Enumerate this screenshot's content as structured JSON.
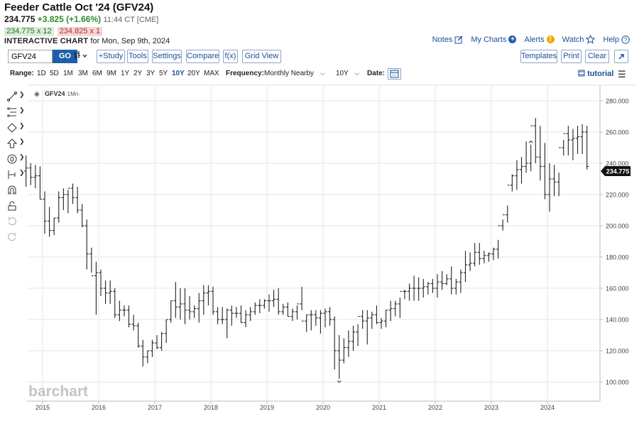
{
  "header": {
    "title": "Feeder Cattle Oct '24 (GFV24)",
    "last": "234.775",
    "change": "+3.825 (+1.66%)",
    "time": "11:44 CT [CME]",
    "bid": "234.775 x 12",
    "ask": "234.825 x 1",
    "chart_label": "INTERACTIVE CHART",
    "chart_date": " for Mon, Sep 9th, 2024"
  },
  "links": {
    "notes": "Notes",
    "mycharts": "My Charts",
    "alerts": "Alerts",
    "watch": "Watch",
    "help": "Help"
  },
  "toolbar": {
    "symbol": "GFV24",
    "go": "GO",
    "study": "+Study",
    "tools": "Tools",
    "settings": "Settings",
    "compare": "Compare",
    "fx": "f(x)",
    "gridview": "Grid View",
    "templates": "Templates",
    "print": "Print",
    "clear": "Clear"
  },
  "rangebar": {
    "range_label": "Range:",
    "ranges": [
      "1D",
      "5D",
      "1M",
      "3M",
      "6M",
      "9M",
      "1Y",
      "2Y",
      "3Y",
      "5Y",
      "10Y",
      "20Y",
      "MAX"
    ],
    "active_range": "10Y",
    "frequency_label": "Frequency:",
    "frequency": "Monthly Nearby",
    "period": "10Y",
    "date_label": "Date:",
    "tutorial": "tutorial"
  },
  "chart_data": {
    "type": "ohlc",
    "symbol_label": "GFV24",
    "interval_label": "·1Mn·",
    "watermark": "barchart",
    "last_price_label": "234.775",
    "ylim": [
      95,
      287
    ],
    "y_ticks": [
      100,
      120,
      140,
      160,
      180,
      200,
      220,
      240,
      260,
      280
    ],
    "x_years": [
      "2015",
      "2016",
      "2017",
      "2018",
      "2019",
      "2020",
      "2021",
      "2022",
      "2023",
      "2024"
    ],
    "x_start": "2014-09",
    "x_end": "2024-09",
    "grid": true,
    "markers": {
      "high": "2023-09",
      "low": "2020-04"
    },
    "months": [
      "2014-09",
      "2014-10",
      "2014-11",
      "2014-12",
      "2015-01",
      "2015-02",
      "2015-03",
      "2015-04",
      "2015-05",
      "2015-06",
      "2015-07",
      "2015-08",
      "2015-09",
      "2015-10",
      "2015-11",
      "2015-12",
      "2016-01",
      "2016-02",
      "2016-03",
      "2016-04",
      "2016-05",
      "2016-06",
      "2016-07",
      "2016-08",
      "2016-09",
      "2016-10",
      "2016-11",
      "2016-12",
      "2017-01",
      "2017-02",
      "2017-03",
      "2017-04",
      "2017-05",
      "2017-06",
      "2017-07",
      "2017-08",
      "2017-09",
      "2017-10",
      "2017-11",
      "2017-12",
      "2018-01",
      "2018-02",
      "2018-03",
      "2018-04",
      "2018-05",
      "2018-06",
      "2018-07",
      "2018-08",
      "2018-09",
      "2018-10",
      "2018-11",
      "2018-12",
      "2019-01",
      "2019-02",
      "2019-03",
      "2019-04",
      "2019-05",
      "2019-06",
      "2019-07",
      "2019-08",
      "2019-09",
      "2019-10",
      "2019-11",
      "2019-12",
      "2020-01",
      "2020-02",
      "2020-03",
      "2020-04",
      "2020-05",
      "2020-06",
      "2020-07",
      "2020-08",
      "2020-09",
      "2020-10",
      "2020-11",
      "2020-12",
      "2021-01",
      "2021-02",
      "2021-03",
      "2021-04",
      "2021-05",
      "2021-06",
      "2021-07",
      "2021-08",
      "2021-09",
      "2021-10",
      "2021-11",
      "2021-12",
      "2022-01",
      "2022-02",
      "2022-03",
      "2022-04",
      "2022-05",
      "2022-06",
      "2022-07",
      "2022-08",
      "2022-09",
      "2022-10",
      "2022-11",
      "2022-12",
      "2023-01",
      "2023-02",
      "2023-03",
      "2023-04",
      "2023-05",
      "2023-06",
      "2023-07",
      "2023-08",
      "2023-09",
      "2023-10",
      "2023-11",
      "2023-12",
      "2024-01",
      "2024-02",
      "2024-03",
      "2024-04",
      "2024-05",
      "2024-06",
      "2024-07",
      "2024-08",
      "2024-09"
    ],
    "open": [
      235,
      237,
      231,
      232,
      217,
      203,
      197,
      205,
      218,
      220,
      224,
      218,
      210,
      200,
      182,
      168,
      170,
      160,
      157,
      158,
      143,
      146,
      146,
      137,
      136,
      123,
      116,
      120,
      125,
      122,
      131,
      140,
      152,
      148,
      150,
      146,
      145,
      147,
      152,
      157,
      158,
      145,
      140,
      140,
      146,
      144,
      144,
      138,
      143,
      145,
      149,
      149,
      152,
      152,
      153,
      145,
      148,
      142,
      145,
      150,
      139,
      143,
      143,
      141,
      144,
      145,
      140,
      120,
      114,
      122,
      126,
      132,
      142,
      139,
      141,
      143,
      138,
      139,
      146,
      147,
      150,
      158,
      158,
      160,
      160,
      160,
      161,
      163,
      160,
      164,
      163,
      166,
      160,
      164,
      170,
      175,
      176,
      183,
      179,
      181,
      182,
      185,
      200,
      207,
      226,
      232,
      236,
      238,
      240,
      264,
      244,
      238,
      220,
      230,
      228,
      250,
      259,
      255,
      256,
      257,
      260,
      238,
      232
    ],
    "high": [
      245,
      240,
      239,
      238,
      222,
      212,
      205,
      222,
      224,
      223,
      227,
      225,
      214,
      204,
      186,
      177,
      172,
      165,
      165,
      160,
      152,
      149,
      149,
      143,
      138,
      127,
      120,
      127,
      130,
      132,
      140,
      152,
      164,
      160,
      160,
      155,
      149,
      157,
      162,
      162,
      161,
      148,
      148,
      147,
      149,
      148,
      149,
      146,
      148,
      151,
      153,
      153,
      156,
      159,
      160,
      150,
      151,
      147,
      149,
      161,
      143,
      146,
      146,
      146,
      147,
      148,
      142,
      130,
      128,
      133,
      136,
      137,
      146,
      146,
      145,
      149,
      141,
      146,
      152,
      152,
      154,
      159,
      163,
      168,
      167,
      166,
      164,
      166,
      169,
      171,
      169,
      174,
      166,
      172,
      184,
      183,
      189,
      189,
      184,
      183,
      186,
      191,
      204,
      213,
      233,
      242,
      244,
      254,
      252,
      269,
      264,
      253,
      240,
      239,
      234,
      255,
      264,
      262,
      264,
      265,
      264,
      258,
      240
    ],
    "low": [
      225,
      226,
      224,
      217,
      195,
      193,
      194,
      202,
      210,
      208,
      214,
      208,
      199,
      172,
      170,
      143,
      155,
      150,
      150,
      141,
      139,
      142,
      135,
      133,
      122,
      110,
      112,
      116,
      121,
      120,
      125,
      138,
      141,
      140,
      137,
      140,
      141,
      138,
      143,
      149,
      143,
      137,
      137,
      128,
      136,
      141,
      138,
      135,
      139,
      143,
      144,
      147,
      145,
      148,
      143,
      143,
      142,
      139,
      140,
      146,
      132,
      133,
      136,
      131,
      135,
      136,
      108,
      102,
      112,
      116,
      120,
      123,
      134,
      124,
      134,
      137,
      134,
      135,
      139,
      142,
      141,
      153,
      152,
      152,
      152,
      154,
      156,
      157,
      154,
      159,
      162,
      156,
      156,
      157,
      164,
      171,
      174,
      175,
      176,
      177,
      178,
      179,
      197,
      202,
      222,
      223,
      227,
      234,
      235,
      240,
      229,
      217,
      209,
      219,
      219,
      245,
      245,
      242,
      246,
      246,
      236,
      230,
      230
    ],
    "close": [
      237,
      231,
      232,
      217,
      203,
      197,
      205,
      218,
      220,
      224,
      218,
      210,
      200,
      182,
      168,
      170,
      160,
      157,
      158,
      143,
      146,
      146,
      137,
      136,
      123,
      116,
      120,
      125,
      122,
      131,
      140,
      152,
      148,
      150,
      146,
      145,
      147,
      152,
      157,
      158,
      145,
      140,
      140,
      146,
      144,
      144,
      138,
      143,
      145,
      149,
      149,
      152,
      152,
      153,
      145,
      148,
      142,
      145,
      150,
      139,
      143,
      143,
      141,
      144,
      145,
      140,
      120,
      114,
      122,
      126,
      132,
      142,
      139,
      141,
      143,
      138,
      139,
      146,
      147,
      150,
      158,
      158,
      160,
      160,
      160,
      161,
      163,
      160,
      164,
      163,
      166,
      160,
      164,
      170,
      175,
      176,
      183,
      179,
      181,
      182,
      185,
      200,
      207,
      226,
      232,
      236,
      238,
      240,
      264,
      244,
      238,
      220,
      230,
      228,
      250,
      259,
      255,
      256,
      257,
      260,
      238,
      232,
      235
    ]
  },
  "drawing_tools": [
    "line-tool",
    "fibonacci-tool",
    "shape-tool",
    "arrow-tool",
    "annotation-tool",
    "measure-tool",
    "magnet-tool",
    "lock-tool",
    "undo-tool",
    "redo-tool"
  ],
  "colors": {
    "accent": "#1f5fa8",
    "up": "#2e8b2e",
    "down": "#a33",
    "bars": "#222"
  }
}
